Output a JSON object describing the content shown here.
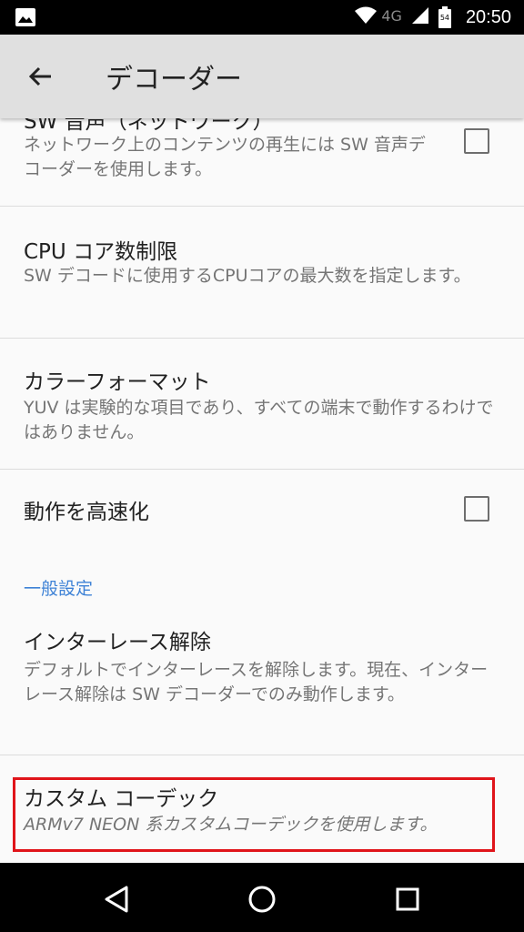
{
  "status_bar": {
    "network_label": "4G",
    "battery_level": "54",
    "clock": "20:50",
    "icons": [
      "image-icon",
      "wifi-icon",
      "signal-icon",
      "battery-icon"
    ]
  },
  "toolbar": {
    "title": "デコーダー",
    "back_icon": "arrow-left-icon"
  },
  "preferences": [
    {
      "title": "SW 音声（ネットワーク）",
      "summary": "ネットワーク上のコンテンツの再生には SW 音声デコーダーを使用します。",
      "checked": false
    },
    {
      "title": "CPU コア数制限",
      "summary": "SW デコードに使用するCPUコアの最大数を指定します。"
    },
    {
      "title": "カラーフォーマット",
      "summary": "YUV は実験的な項目であり、すべての端末で動作するわけではありません。"
    },
    {
      "title": "動作を高速化",
      "checked": false
    },
    {
      "category": "一般設定"
    },
    {
      "title": "インターレース解除",
      "summary": "デフォルトでインターレースを解除します。現在、インターレース解除は SW デコーダーでのみ動作します。"
    },
    {
      "title": "カスタム コーデック",
      "summary": "ARMv7 NEON 系カスタムコーデックを使用します。",
      "highlighted": true
    }
  ],
  "nav_bar": {
    "icons": [
      "back-triangle-icon",
      "home-circle-icon",
      "recents-square-icon"
    ]
  },
  "colors": {
    "accent": "#3e82d6",
    "highlight_border": "#e0141a",
    "toolbar": "#e0e0e0"
  }
}
